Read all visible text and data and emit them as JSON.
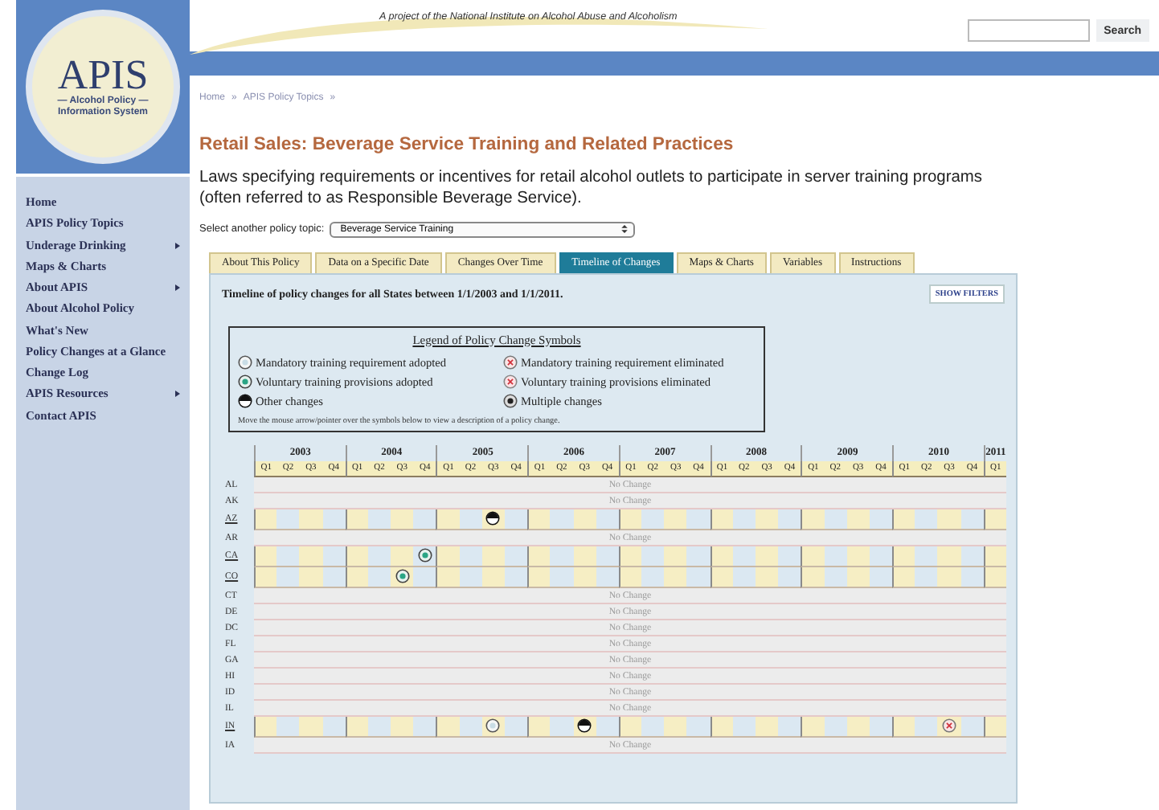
{
  "header": {
    "tagline": "A project of the National Institute on Alcohol Abuse and Alcoholism",
    "search_button": "Search"
  },
  "logo": {
    "name": "APIS",
    "subtitle_1": "— Alcohol Policy —",
    "subtitle_2": "Information System"
  },
  "sidebar": {
    "items": [
      {
        "label": "Home",
        "has_submenu": false
      },
      {
        "label": "APIS Policy Topics",
        "has_submenu": false
      },
      {
        "label": "Underage Drinking",
        "has_submenu": true
      },
      {
        "label": "Maps & Charts",
        "has_submenu": false
      },
      {
        "label": "About APIS",
        "has_submenu": true
      },
      {
        "label": "About Alcohol Policy",
        "has_submenu": false
      },
      {
        "label": "What's New",
        "has_submenu": false
      },
      {
        "label": "Policy Changes at a Glance",
        "has_submenu": false
      },
      {
        "label": "Change Log",
        "has_submenu": false
      },
      {
        "label": "APIS Resources",
        "has_submenu": true
      },
      {
        "label": "Contact APIS",
        "has_submenu": false
      }
    ]
  },
  "breadcrumb": [
    {
      "label": "Home",
      "separator": "»"
    },
    {
      "label": "APIS Policy Topics",
      "separator": "»"
    }
  ],
  "title": "Retail Sales: Beverage Service Training and Related Practices",
  "description": "Laws specifying requirements or incentives for retail alcohol outlets to participate in server training programs (often referred to as Responsible Beverage Service).",
  "topic_select": {
    "label": "Select another policy topic:",
    "value": "Beverage Service Training"
  },
  "tabs": [
    {
      "label": "About This Policy",
      "selected": false
    },
    {
      "label": "Data on a Specific Date",
      "selected": false
    },
    {
      "label": "Changes Over Time",
      "selected": false
    },
    {
      "label": "Timeline of Changes",
      "selected": true
    },
    {
      "label": "Maps & Charts",
      "selected": false
    },
    {
      "label": "Variables",
      "selected": false
    },
    {
      "label": "Instructions",
      "selected": false
    }
  ],
  "panel": {
    "heading": "Timeline of policy changes for all States between 1/1/2003 and 1/1/2011.",
    "filter_button": "SHOW FILTERS"
  },
  "legend": {
    "title": "Legend of Policy Change Symbols",
    "items": [
      {
        "kind": "mandatory_adopted",
        "label": "Mandatory training requirement adopted"
      },
      {
        "kind": "mandatory_eliminated",
        "label": "Mandatory training requirement eliminated"
      },
      {
        "kind": "voluntary_adopted",
        "label": "Voluntary training provisions adopted"
      },
      {
        "kind": "voluntary_eliminated",
        "label": "Voluntary training provisions eliminated"
      },
      {
        "kind": "other",
        "label": "Other changes"
      },
      {
        "kind": "multiple",
        "label": "Multiple changes"
      }
    ],
    "note": "Move the mouse arrow/pointer over the symbols below to view a description of a policy change."
  },
  "grid": {
    "years": [
      {
        "label": "2003",
        "quarters": [
          "Q1",
          "Q2",
          "Q3",
          "Q4"
        ]
      },
      {
        "label": "2004",
        "quarters": [
          "Q1",
          "Q2",
          "Q3",
          "Q4"
        ]
      },
      {
        "label": "2005",
        "quarters": [
          "Q1",
          "Q2",
          "Q3",
          "Q4"
        ]
      },
      {
        "label": "2006",
        "quarters": [
          "Q1",
          "Q2",
          "Q3",
          "Q4"
        ]
      },
      {
        "label": "2007",
        "quarters": [
          "Q1",
          "Q2",
          "Q3",
          "Q4"
        ]
      },
      {
        "label": "2008",
        "quarters": [
          "Q1",
          "Q2",
          "Q3",
          "Q4"
        ]
      },
      {
        "label": "2009",
        "quarters": [
          "Q1",
          "Q2",
          "Q3",
          "Q4"
        ]
      },
      {
        "label": "2010",
        "quarters": [
          "Q1",
          "Q2",
          "Q3",
          "Q4"
        ]
      },
      {
        "label": "2011",
        "quarters": [
          "Q1"
        ]
      }
    ],
    "rows": [
      {
        "state": "AL",
        "linked": false,
        "status": "No Change"
      },
      {
        "state": "AK",
        "linked": false,
        "status": "No Change"
      },
      {
        "state": "AZ",
        "linked": true,
        "quarters": [
          {
            "kind": "blank"
          },
          {
            "kind": "blank"
          },
          {
            "kind": "blank"
          },
          {
            "kind": "blank"
          },
          {
            "kind": "blank"
          },
          {
            "kind": "blank"
          },
          {
            "kind": "blank"
          },
          {
            "kind": "blank"
          },
          {
            "kind": "blank"
          },
          {
            "kind": "blank"
          },
          {
            "kind": "other"
          },
          {
            "kind": "blank"
          },
          {
            "kind": "blank"
          },
          {
            "kind": "blank"
          },
          {
            "kind": "blank"
          },
          {
            "kind": "blank"
          },
          {
            "kind": "blank"
          },
          {
            "kind": "blank"
          },
          {
            "kind": "blank"
          },
          {
            "kind": "blank"
          },
          {
            "kind": "blank"
          },
          {
            "kind": "blank"
          },
          {
            "kind": "blank"
          },
          {
            "kind": "blank"
          },
          {
            "kind": "blank"
          },
          {
            "kind": "blank"
          },
          {
            "kind": "blank"
          },
          {
            "kind": "blank"
          },
          {
            "kind": "blank"
          },
          {
            "kind": "blank"
          },
          {
            "kind": "blank"
          },
          {
            "kind": "blank"
          },
          {
            "kind": "blank"
          }
        ]
      },
      {
        "state": "AR",
        "linked": false,
        "status": "No Change"
      },
      {
        "state": "CA",
        "linked": true,
        "quarters": [
          {
            "kind": "blank"
          },
          {
            "kind": "blank"
          },
          {
            "kind": "blank"
          },
          {
            "kind": "blank"
          },
          {
            "kind": "blank"
          },
          {
            "kind": "blank"
          },
          {
            "kind": "blank"
          },
          {
            "kind": "voluntary_adopted"
          },
          {
            "kind": "blank"
          },
          {
            "kind": "blank"
          },
          {
            "kind": "blank"
          },
          {
            "kind": "blank"
          },
          {
            "kind": "blank"
          },
          {
            "kind": "blank"
          },
          {
            "kind": "blank"
          },
          {
            "kind": "blank"
          },
          {
            "kind": "blank"
          },
          {
            "kind": "blank"
          },
          {
            "kind": "blank"
          },
          {
            "kind": "blank"
          },
          {
            "kind": "blank"
          },
          {
            "kind": "blank"
          },
          {
            "kind": "blank"
          },
          {
            "kind": "blank"
          },
          {
            "kind": "blank"
          },
          {
            "kind": "blank"
          },
          {
            "kind": "blank"
          },
          {
            "kind": "blank"
          },
          {
            "kind": "blank"
          },
          {
            "kind": "blank"
          },
          {
            "kind": "blank"
          },
          {
            "kind": "blank"
          },
          {
            "kind": "blank"
          }
        ]
      },
      {
        "state": "CO",
        "linked": true,
        "quarters": [
          {
            "kind": "blank"
          },
          {
            "kind": "blank"
          },
          {
            "kind": "blank"
          },
          {
            "kind": "blank"
          },
          {
            "kind": "blank"
          },
          {
            "kind": "blank"
          },
          {
            "kind": "voluntary_adopted"
          },
          {
            "kind": "blank"
          },
          {
            "kind": "blank"
          },
          {
            "kind": "blank"
          },
          {
            "kind": "blank"
          },
          {
            "kind": "blank"
          },
          {
            "kind": "blank"
          },
          {
            "kind": "blank"
          },
          {
            "kind": "blank"
          },
          {
            "kind": "blank"
          },
          {
            "kind": "blank"
          },
          {
            "kind": "blank"
          },
          {
            "kind": "blank"
          },
          {
            "kind": "blank"
          },
          {
            "kind": "blank"
          },
          {
            "kind": "blank"
          },
          {
            "kind": "blank"
          },
          {
            "kind": "blank"
          },
          {
            "kind": "blank"
          },
          {
            "kind": "blank"
          },
          {
            "kind": "blank"
          },
          {
            "kind": "blank"
          },
          {
            "kind": "blank"
          },
          {
            "kind": "blank"
          },
          {
            "kind": "blank"
          },
          {
            "kind": "blank"
          },
          {
            "kind": "blank"
          }
        ]
      },
      {
        "state": "CT",
        "linked": false,
        "status": "No Change"
      },
      {
        "state": "DE",
        "linked": false,
        "status": "No Change"
      },
      {
        "state": "DC",
        "linked": false,
        "status": "No Change"
      },
      {
        "state": "FL",
        "linked": false,
        "status": "No Change"
      },
      {
        "state": "GA",
        "linked": false,
        "status": "No Change"
      },
      {
        "state": "HI",
        "linked": false,
        "status": "No Change"
      },
      {
        "state": "ID",
        "linked": false,
        "status": "No Change"
      },
      {
        "state": "IL",
        "linked": false,
        "status": "No Change"
      },
      {
        "state": "IN",
        "linked": true,
        "quarters": [
          {
            "kind": "blank"
          },
          {
            "kind": "blank"
          },
          {
            "kind": "blank"
          },
          {
            "kind": "blank"
          },
          {
            "kind": "blank"
          },
          {
            "kind": "blank"
          },
          {
            "kind": "blank"
          },
          {
            "kind": "blank"
          },
          {
            "kind": "blank"
          },
          {
            "kind": "blank"
          },
          {
            "kind": "mandatory_adopted"
          },
          {
            "kind": "blank"
          },
          {
            "kind": "blank"
          },
          {
            "kind": "blank"
          },
          {
            "kind": "other"
          },
          {
            "kind": "blank"
          },
          {
            "kind": "blank"
          },
          {
            "kind": "blank"
          },
          {
            "kind": "blank"
          },
          {
            "kind": "blank"
          },
          {
            "kind": "blank"
          },
          {
            "kind": "blank"
          },
          {
            "kind": "blank"
          },
          {
            "kind": "blank"
          },
          {
            "kind": "blank"
          },
          {
            "kind": "blank"
          },
          {
            "kind": "blank"
          },
          {
            "kind": "blank"
          },
          {
            "kind": "blank"
          },
          {
            "kind": "blank"
          },
          {
            "kind": "mandatory_eliminated"
          },
          {
            "kind": "blank"
          },
          {
            "kind": "blank"
          }
        ]
      },
      {
        "state": "IA",
        "linked": false,
        "status": "No Change"
      }
    ]
  }
}
